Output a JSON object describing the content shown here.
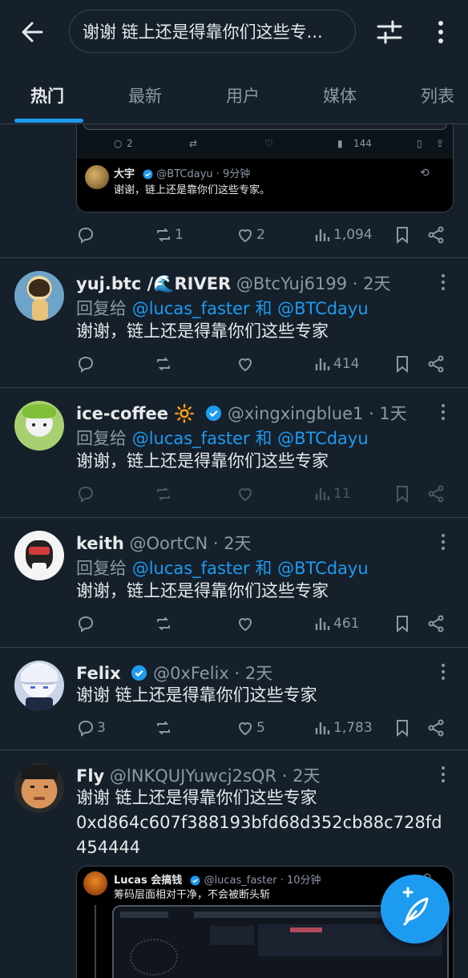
{
  "search": {
    "query": "谢谢 链上还是得靠你们这些专..."
  },
  "tabs": [
    "热门",
    "最新",
    "用户",
    "媒体",
    "列表"
  ],
  "top_embed": {
    "mini_counts": {
      "replies": "2",
      "views": "144"
    },
    "quoted": {
      "name": "大宇",
      "handle": "@BTCdayu",
      "time": "· 9分钟",
      "text": "谢谢，链上还是靠你们这些专家。"
    }
  },
  "top_actions": {
    "replies": "",
    "retweets": "1",
    "likes": "2",
    "views": "1,094"
  },
  "tweets": [
    {
      "name": "yuj.btc /🌊RIVER",
      "handle": "@BtcYuj6199",
      "time": "· 2天",
      "reply_prefix": "回复给",
      "mention1": "@lucas_faster",
      "and": "和",
      "mention2": "@BTCdayu",
      "text": "谢谢，链上还是得靠你们这些专家",
      "replies": "",
      "retweets": "",
      "likes": "",
      "views": "414"
    },
    {
      "name": "ice-coffee 🔆",
      "handle": "@xingxingblue1",
      "time": "· 1天",
      "reply_prefix": "回复给",
      "mention1": "@lucas_faster",
      "and": "和",
      "mention2": "@BTCdayu",
      "text": "谢谢，链上还是得靠你们这些专家",
      "replies": "",
      "retweets": "",
      "likes": "",
      "views": "11"
    },
    {
      "name": "keith",
      "handle": "@OortCN",
      "time": "· 2天",
      "reply_prefix": "回复给",
      "mention1": "@lucas_faster",
      "and": "和",
      "mention2": "@BTCdayu",
      "text": "谢谢，链上还是得靠你们这些专家",
      "replies": "",
      "retweets": "",
      "likes": "",
      "views": "461"
    },
    {
      "name": "Felix",
      "handle": "@0xFelix",
      "time": "· 2天",
      "text": "谢谢 链上还是得靠你们这些专家",
      "replies": "3",
      "retweets": "",
      "likes": "5",
      "views": "1,783"
    },
    {
      "name": "Fly",
      "handle": "@lNKQUJYuwcj2sQR",
      "time": "· 2天",
      "text": "谢谢 链上还是得靠你们这些专家",
      "text2": "0xd864c607f388193bfd68d352cb88c728fd",
      "text3": "454444"
    }
  ],
  "quote_card": {
    "name": "Lucas 会搞钱",
    "handle": "@lucas_faster",
    "time": "· 10分钟",
    "text": "筹码层面相对干净，不会被断头斩"
  },
  "colors": {
    "background": "#15202b",
    "accent": "#1d9bf0",
    "muted": "#8b98a5",
    "border": "#38444d",
    "verified": "#1d9bf0"
  }
}
